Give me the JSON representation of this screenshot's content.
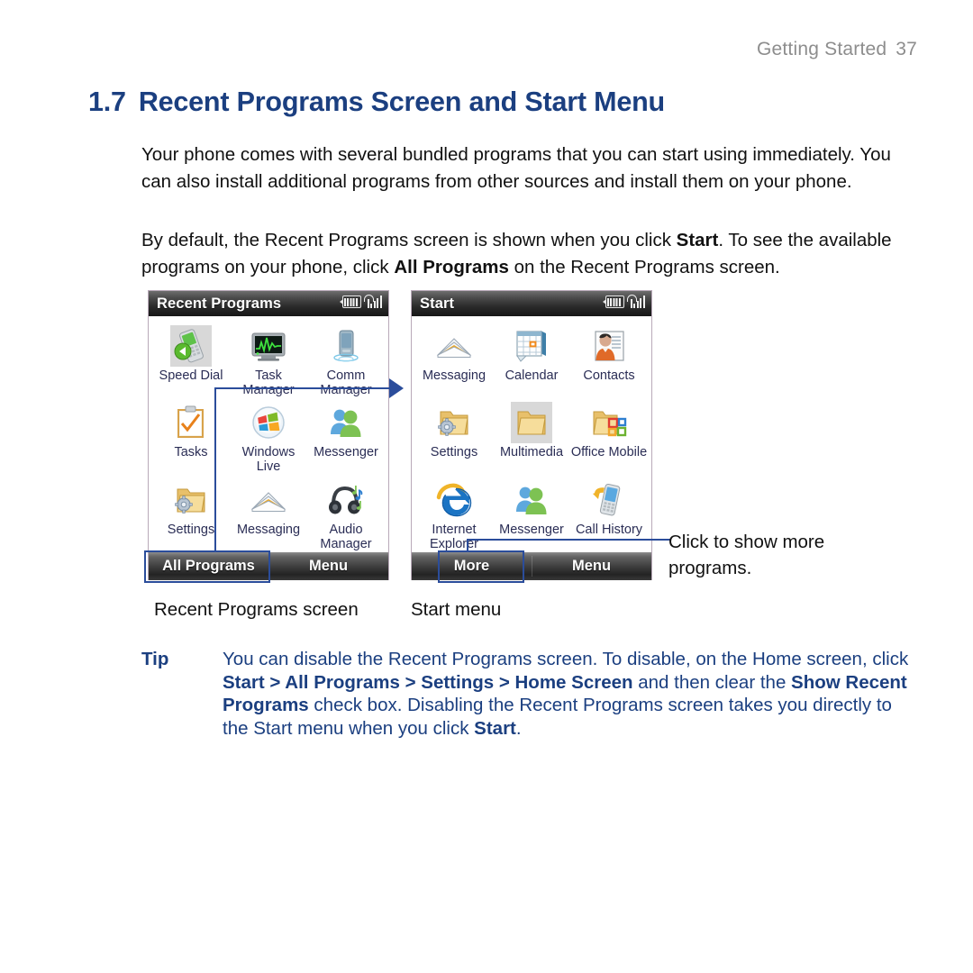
{
  "running_head": {
    "text": "Getting Started",
    "page_number": "37"
  },
  "section": {
    "number": "1.7",
    "title": "Recent Programs Screen and Start Menu"
  },
  "paragraphs": {
    "p1": "Your phone comes with several bundled programs that you can start using immediately. You can also install additional programs from other sources and install them on your phone.",
    "p2_a": "By default, the Recent Programs screen is shown when you click ",
    "p2_b": "Start",
    "p2_c": ". To see the available programs on your phone, click ",
    "p2_d": "All Programs",
    "p2_e": " on the Recent Programs screen."
  },
  "figure": {
    "recent_screen": {
      "title": "Recent Programs",
      "caption": "Recent Programs screen",
      "status_icons": [
        "battery-icon",
        "signal-icon"
      ],
      "items": [
        {
          "label": "Speed Dial",
          "icon": "speed-dial-icon",
          "selected": true
        },
        {
          "label": "Task Manager",
          "icon": "task-manager-icon",
          "selected": false
        },
        {
          "label": "Comm\nManager",
          "icon": "comm-manager-icon",
          "selected": false
        },
        {
          "label": "Tasks",
          "icon": "tasks-icon",
          "selected": false
        },
        {
          "label": "Windows Live",
          "icon": "windows-live-icon",
          "selected": false
        },
        {
          "label": "Messenger",
          "icon": "messenger-icon",
          "selected": false
        },
        {
          "label": "Settings",
          "icon": "settings-folder-icon",
          "selected": false
        },
        {
          "label": "Messaging",
          "icon": "messaging-icon",
          "selected": false
        },
        {
          "label": "Audio\nManager",
          "icon": "audio-manager-icon",
          "selected": false
        }
      ],
      "softkeys": {
        "left": "All Programs",
        "right": "Menu"
      }
    },
    "start_screen": {
      "title": "Start",
      "caption": "Start menu",
      "status_icons": [
        "battery-icon",
        "signal-icon"
      ],
      "items": [
        {
          "label": "Messaging",
          "icon": "messaging-icon",
          "selected": false
        },
        {
          "label": "Calendar",
          "icon": "calendar-icon",
          "selected": false
        },
        {
          "label": "Contacts",
          "icon": "contacts-icon",
          "selected": false
        },
        {
          "label": "Settings",
          "icon": "settings-folder-icon",
          "selected": false
        },
        {
          "label": "Multimedia",
          "icon": "multimedia-folder-icon",
          "selected": true
        },
        {
          "label": "Office Mobile",
          "icon": "office-mobile-icon",
          "selected": false
        },
        {
          "label": "Internet\nExplorer",
          "icon": "internet-explorer-icon",
          "selected": false
        },
        {
          "label": "Messenger",
          "icon": "messenger-icon",
          "selected": false
        },
        {
          "label": "Call History",
          "icon": "call-history-icon",
          "selected": false
        }
      ],
      "softkeys": {
        "left": "More",
        "right": "Menu"
      }
    },
    "callout_more": "Click to show more programs."
  },
  "tip": {
    "label": "Tip",
    "t1": "You can disable the Recent Programs screen. To disable, on the Home screen, click ",
    "t2": "Start > All Programs > Settings > Home Screen",
    "t3": " and then clear the ",
    "t4": "Show Recent Programs",
    "t5": " check box. Disabling the Recent Programs screen takes you directly to the Start menu when you click ",
    "t6": "Start",
    "t7": "."
  },
  "colors": {
    "heading_blue": "#1b3f80",
    "tip_blue": "#1b3f80",
    "callout_blue": "#2b4d9b",
    "running_head_gray": "#8d8d8d",
    "icon_label_blue": "#2a2d55"
  }
}
